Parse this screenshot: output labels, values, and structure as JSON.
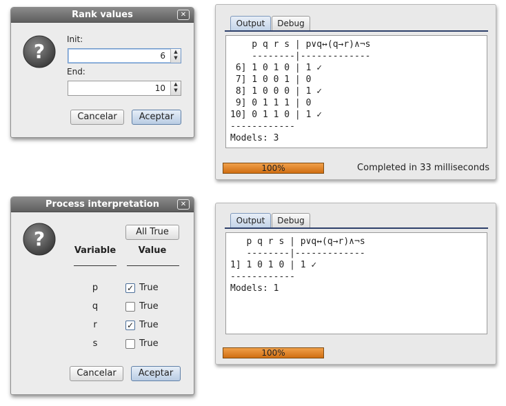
{
  "rank_dialog": {
    "title": "Rank values",
    "close_glyph": "✕",
    "icon": "question-icon",
    "init_label": "Init:",
    "init_value": "6",
    "end_label": "End:",
    "end_value": "10",
    "cancel_label": "Cancelar",
    "accept_label": "Aceptar"
  },
  "interp_dialog": {
    "title": "Process interpretation",
    "close_glyph": "✕",
    "icon": "question-icon",
    "all_true_label": "All True",
    "variable_header": "Variable",
    "value_header": "Value",
    "rows": [
      {
        "var": "p",
        "checked": true,
        "label": "True"
      },
      {
        "var": "q",
        "checked": false,
        "label": "True"
      },
      {
        "var": "r",
        "checked": true,
        "label": "True"
      },
      {
        "var": "s",
        "checked": false,
        "label": "True"
      }
    ],
    "cancel_label": "Cancelar",
    "accept_label": "Aceptar"
  },
  "output_top": {
    "tabs": [
      {
        "label": "Output",
        "selected": true
      },
      {
        "label": "Debug",
        "selected": false
      }
    ],
    "text": "    p q r s | p∨q↔(q→r)∧¬s\n    --------|-------------\n 6] 1 0 1 0 | 1 ✓\n 7] 1 0 0 1 | 0\n 8] 1 0 0 0 | 1 ✓\n 9] 0 1 1 1 | 0\n10] 0 1 1 0 | 1 ✓\n------------\nModels: 3",
    "progress_label": "100%",
    "progress_fraction": 1.0,
    "status": "Completed in 33 milliseconds"
  },
  "output_bottom": {
    "tabs": [
      {
        "label": "Output",
        "selected": true
      },
      {
        "label": "Debug",
        "selected": false
      }
    ],
    "text": "   p q r s | p∨q↔(q→r)∧¬s\n   --------|-------------\n1] 1 0 1 0 | 1 ✓\n------------\nModels: 1",
    "progress_label": "100%",
    "progress_fraction": 1.0
  },
  "colors": {
    "progress": "#e07f1f",
    "title_bar": "#6e6e6e",
    "default_button": "#c4d4e8"
  }
}
